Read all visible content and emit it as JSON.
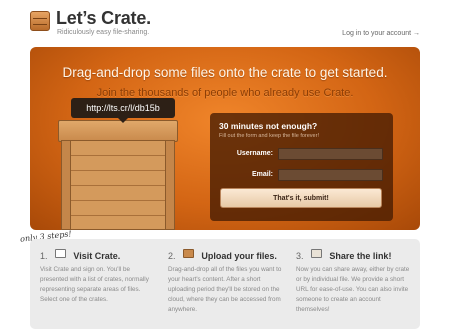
{
  "header": {
    "title": "Let’s Crate.",
    "tagline": "Ridiculously easy file-sharing.",
    "login_link": "Log in to your account →"
  },
  "hero": {
    "headline": "Drag-and-drop some files onto the crate to get started.",
    "subheadline": "Join the thousands of people who already use Crate.",
    "url_tooltip": "http://lts.cr/l/db15b"
  },
  "form": {
    "title": "30 minutes not enough?",
    "subtitle": "Fill out the form and keep the file forever!",
    "username_label": "Username:",
    "email_label": "Email:",
    "submit_label": "That's it, submit!"
  },
  "steps_tag": "only 3 steps!",
  "steps": [
    {
      "number": "1.",
      "icon": "browser-window-icon",
      "title": "Visit Crate.",
      "body": "Visit Crate and sign on. You'll be presented with a list of crates, normally representing separate areas of files. Select one of the crates."
    },
    {
      "number": "2.",
      "icon": "crate-icon",
      "title": "Upload your files.",
      "body": "Drag-and-drop all of the files you want to your heart's content. After a short uploading period they'll be stored on the cloud, where they can be accessed from anywhere."
    },
    {
      "number": "3.",
      "icon": "share-icon",
      "title": "Share the link!",
      "body": "Now you can share away, either by crate or by individual file. We provide a short URL for ease-of-use. You can also invite someone to create an account themselves!"
    }
  ]
}
